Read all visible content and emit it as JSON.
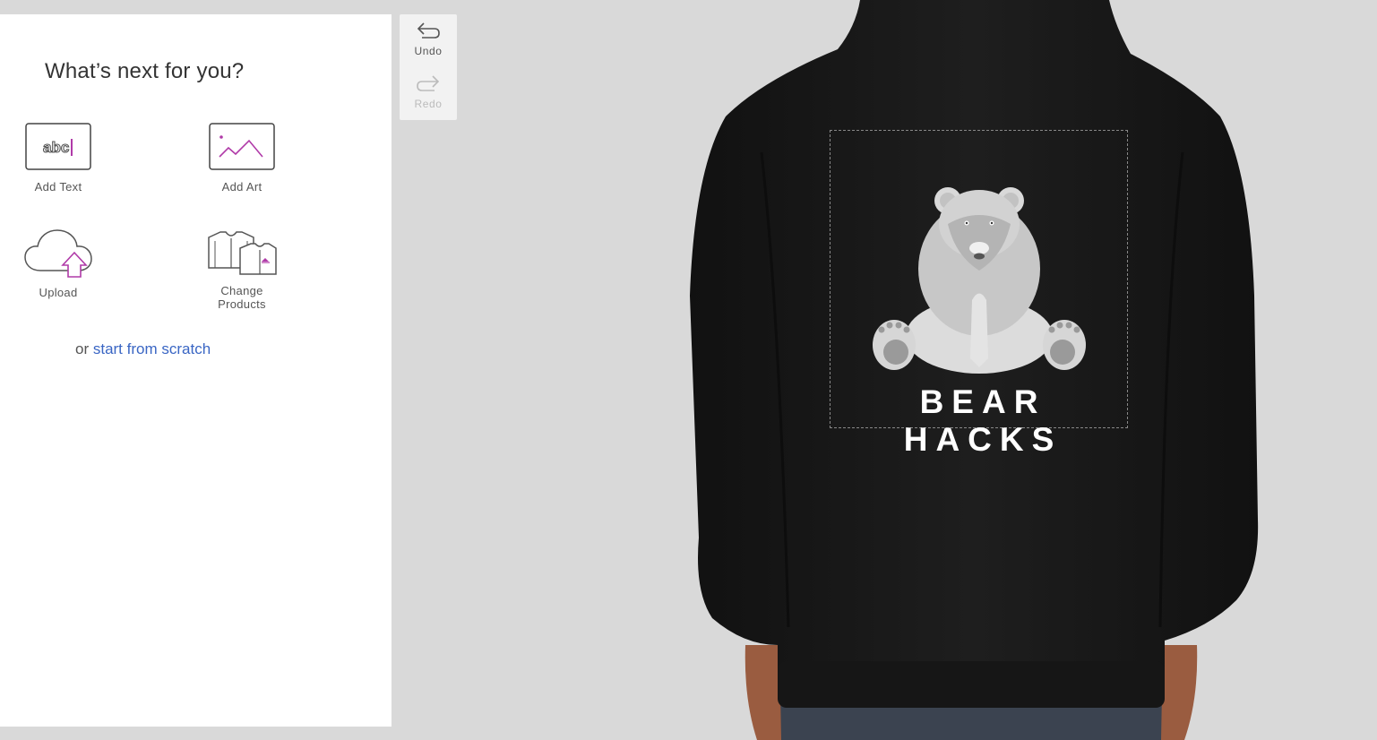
{
  "panel": {
    "title": "What’s next for you?",
    "actions": {
      "add_text": {
        "label": "Add Text",
        "icon": "text-cursor-icon",
        "glyph": "abc"
      },
      "add_art": {
        "label": "Add Art",
        "icon": "image-icon"
      },
      "upload": {
        "label": "Upload",
        "icon": "cloud-upload-icon"
      },
      "change_products": {
        "label": "Change\nProducts",
        "icon": "shirts-icon"
      }
    },
    "scratch": {
      "prefix": "or ",
      "link": "start from scratch"
    }
  },
  "history": {
    "undo": {
      "label": "Undo",
      "enabled": true
    },
    "redo": {
      "label": "Redo",
      "enabled": false
    }
  },
  "product": {
    "type": "hoodie",
    "color": "#1b1b1b",
    "view": "back",
    "design": {
      "text": "BEAR HACKS",
      "art": "polar-bear"
    }
  },
  "colors": {
    "accent": "#b03aa8",
    "link": "#3a66c4",
    "background": "#d9d9d9"
  }
}
